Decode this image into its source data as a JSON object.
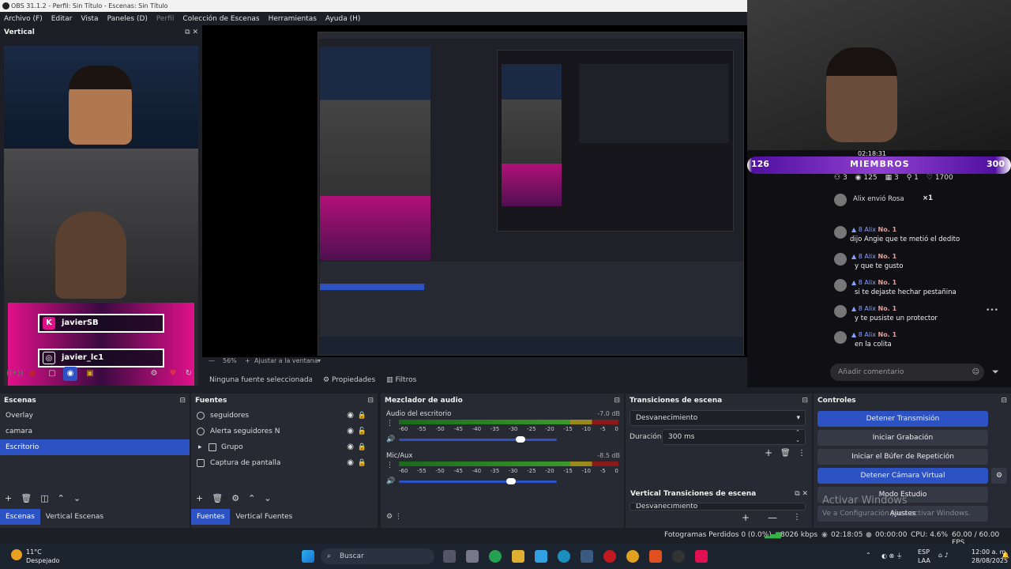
{
  "window": {
    "title": "OBS 31.1.2 - Perfil: Sin Título - Escenas: Sin Título"
  },
  "menu": [
    {
      "label": "Archivo (F)",
      "dim": false
    },
    {
      "label": "Editar",
      "dim": false
    },
    {
      "label": "Vista",
      "dim": false
    },
    {
      "label": "Paneles (D)",
      "dim": false
    },
    {
      "label": "Perfil",
      "dim": true
    },
    {
      "label": "Colección de Escenas",
      "dim": false
    },
    {
      "label": "Herramientas",
      "dim": false
    },
    {
      "label": "Ayuda (H)",
      "dim": false
    }
  ],
  "vertical": {
    "title": "Vertical",
    "name1": "javierSB",
    "name2": "javier_lc1"
  },
  "preview_bar": {
    "zoom": "56%",
    "fit": "Ajustar a la ventana"
  },
  "prop_bar": {
    "source": "Ninguna fuente seleccionada",
    "properties": "Propiedades",
    "filters": "Filtros"
  },
  "tiktok": {
    "members_left": "126",
    "members_label": "MIEMBROS",
    "members_right": "300",
    "timer": "02:18:31",
    "stats": [
      "3",
      "125",
      "3",
      "1",
      "1700"
    ],
    "gift": "Alix envió Rosa",
    "gift_count": "×1",
    "messages": [
      {
        "user": "Alix",
        "badge": "No. 1",
        "level": "8",
        "text": "dijo Angie que te metió el dedito"
      },
      {
        "user": "Alix",
        "badge": "No. 1",
        "level": "8",
        "text": "y que te gusto"
      },
      {
        "user": "Alix",
        "badge": "No. 1",
        "level": "8",
        "text": "si te dejaste hechar pestañina"
      },
      {
        "user": "Alix",
        "badge": "No. 1",
        "level": "8",
        "text": "y te pusiste un protector"
      },
      {
        "user": "Alix",
        "badge": "No. 1",
        "level": "8",
        "text": "en la colita"
      }
    ],
    "comment_placeholder": "Añadir comentario"
  },
  "scenes": {
    "title": "Escenas",
    "items": [
      "Overlay",
      "camara",
      "Escritorio"
    ],
    "selected": 2,
    "tabs": [
      "Escenas",
      "Vertical Escenas"
    ]
  },
  "sources": {
    "title": "Fuentes",
    "items": [
      "seguidores",
      "Alerta seguidores N",
      "Grupo",
      "Captura de pantalla"
    ],
    "tabs": [
      "Fuentes",
      "Vertical Fuentes"
    ]
  },
  "mixer": {
    "title": "Mezclador de audio",
    "channels": [
      {
        "name": "Audio del escritorio",
        "db": "-7.0 dB",
        "level": 0.77
      },
      {
        "name": "Mic/Aux",
        "db": "-8.5 dB",
        "level": 0.71
      }
    ],
    "ticks": [
      "-60",
      "-55",
      "-50",
      "-45",
      "-40",
      "-35",
      "-30",
      "-25",
      "-20",
      "-15",
      "-10",
      "-5",
      "0"
    ]
  },
  "transitions": {
    "title": "Transiciones de escena",
    "selected": "Desvanecimiento",
    "duration_label": "Duración",
    "duration": "300 ms",
    "vertical_title": "Vertical Transiciones de escena",
    "vertical_selected": "Desvanecimiento"
  },
  "controls": {
    "title": "Controles",
    "buttons": [
      {
        "label": "Detener Transmisión",
        "active": true
      },
      {
        "label": "Iniciar Grabación",
        "active": false
      },
      {
        "label": "Iniciar el Búfer de Repetición",
        "active": false
      },
      {
        "label": "Detener Cámara Virtual",
        "active": true
      },
      {
        "label": "Modo Estudio",
        "active": false
      },
      {
        "label": "Ajustes",
        "active": false
      }
    ]
  },
  "watermark": {
    "line1": "Activar Windows",
    "line2": "Ve a Configuración para activar Windows."
  },
  "status": {
    "frames": "Fotogramas Perdidos 0 (0.0%)",
    "bitrate": "8026 kbps",
    "stream_time": "02:18:05",
    "rec_time": "00:00:00",
    "cpu": "CPU: 4.6%",
    "fps": "60.00 / 60.00 FPS"
  },
  "taskbar": {
    "weather_temp": "11°C",
    "weather_desc": "Despejado",
    "search": "Buscar",
    "lang1": "ESP",
    "lang2": "LAA",
    "time": "12:00 a. m.",
    "date": "28/08/2025"
  },
  "colors": {
    "accent": "#2c52c4",
    "panel": "#272a33",
    "bg": "#1e1f26",
    "tiktok_pink": "#e01088"
  }
}
